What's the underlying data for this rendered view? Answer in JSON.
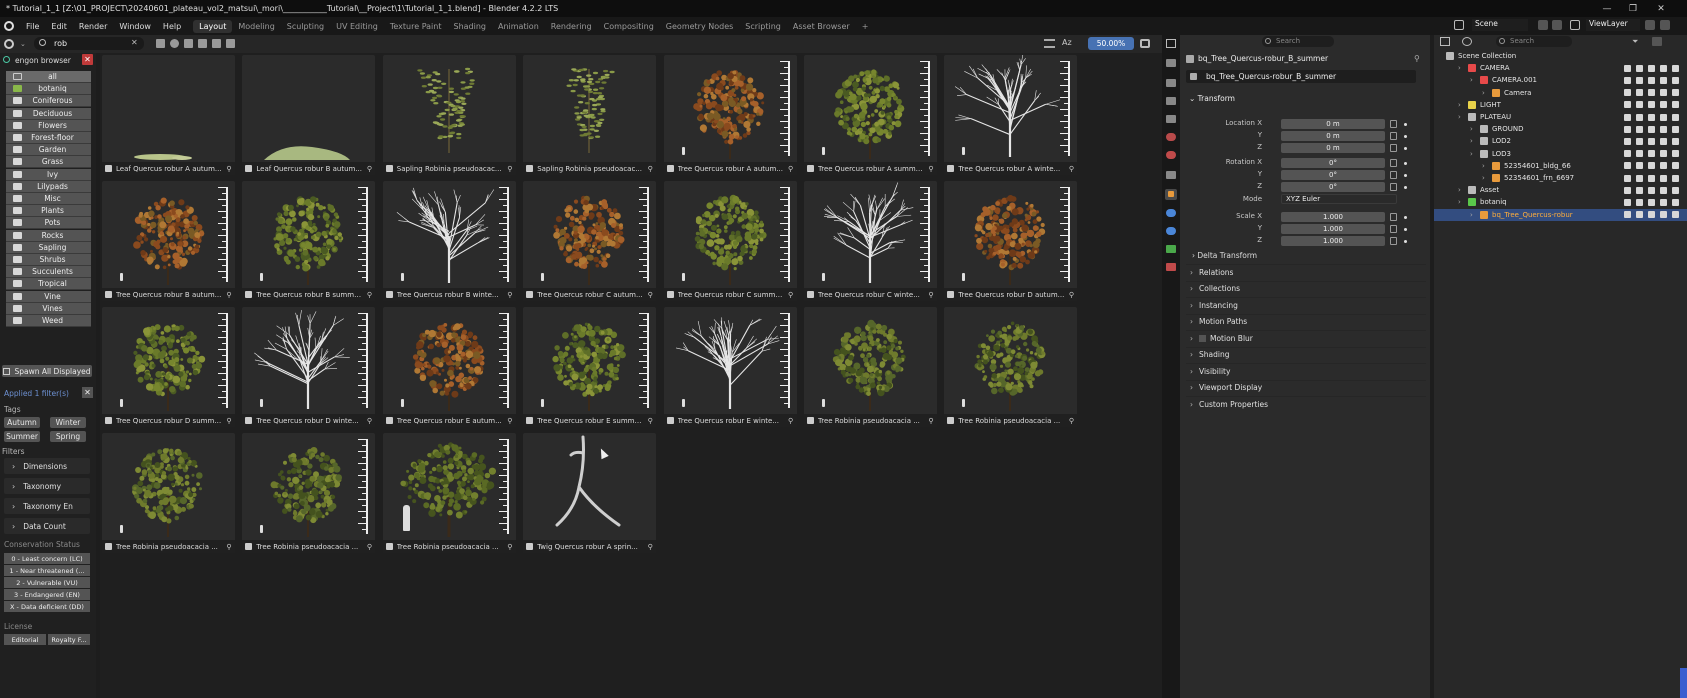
{
  "window": {
    "title": "* Tutorial_1_1 [Z:\\01_PROJECT\\20240601_plateau_vol2_matsui\\_mori\\___________Tutorial\\__Project\\1\\Tutorial_1_1.blend] - Blender 4.2.2 LTS",
    "controls": [
      "—",
      "❐",
      "✕"
    ]
  },
  "menu": [
    "File",
    "Edit",
    "Render",
    "Window",
    "Help"
  ],
  "workspaces": [
    "Layout",
    "Modeling",
    "Sculpting",
    "UV Editing",
    "Texture Paint",
    "Shading",
    "Animation",
    "Rendering",
    "Compositing",
    "Geometry Nodes",
    "Scripting",
    "Asset Browser"
  ],
  "workspace_active": "Layout",
  "workspace_add": "+",
  "scene": {
    "label": "Scene",
    "view_layer": "ViewLayer"
  },
  "browser": {
    "search_value": "rob",
    "zoom": "50.00%",
    "sort_label": "Az",
    "title": "engon browser",
    "close": "✕",
    "categories": [
      "all",
      "botaniq",
      "Coniferous",
      "Deciduous",
      "Flowers",
      "Forest-floor",
      "Garden",
      "Grass",
      "Ivy",
      "Lilypads",
      "Misc",
      "Plants",
      "Pots",
      "Rocks",
      "Sapling",
      "Shrubs",
      "Succulents",
      "Tropical",
      "Vine",
      "Vines",
      "Weed"
    ],
    "spawn_label": "Spawn All Displayed",
    "applied_filters": "Applied 1 filter(s)",
    "tags_label": "Tags",
    "tags": [
      "Autumn",
      "Winter",
      "Summer",
      "Spring"
    ],
    "filters_label": "Filters",
    "filters": [
      "Dimensions",
      "Taxonomy",
      "Taxonomy En",
      "Data Count"
    ],
    "conservation_label": "Conservation Status",
    "conservation": [
      "0 - Least concern (LC)",
      "1 - Near threatened (...",
      "2 - Vulnerable (VU)",
      "3 - Endangered (EN)",
      "X - Data deficient (DD)"
    ],
    "license_label": "License",
    "licenses": [
      "Editorial",
      "Royalty F..."
    ]
  },
  "assets": [
    {
      "name": "Leaf Quercus robur A autum...",
      "kind": "leafA"
    },
    {
      "name": "Leaf Quercus robur B autum...",
      "kind": "leafB"
    },
    {
      "name": "Sapling Robinia pseudoacac...",
      "kind": "sapling"
    },
    {
      "name": "Sapling Robinia pseudoacac...",
      "kind": "sapling2"
    },
    {
      "name": "Tree Quercus robur A autum...",
      "kind": "autumn"
    },
    {
      "name": "Tree Quercus robur A summe...",
      "kind": "summer"
    },
    {
      "name": "Tree Quercus robur A winte...",
      "kind": "winter"
    },
    {
      "name": "Tree Quercus robur B autum...",
      "kind": "autumn"
    },
    {
      "name": "Tree Quercus robur B summe...",
      "kind": "summer"
    },
    {
      "name": "Tree Quercus robur B winte...",
      "kind": "winter"
    },
    {
      "name": "Tree Quercus robur C autum...",
      "kind": "autumn"
    },
    {
      "name": "Tree Quercus robur C summe...",
      "kind": "summer"
    },
    {
      "name": "Tree Quercus robur C winte...",
      "kind": "winter"
    },
    {
      "name": "Tree Quercus robur D autum...",
      "kind": "autumn"
    },
    {
      "name": "Tree Quercus robur D summe...",
      "kind": "summer"
    },
    {
      "name": "Tree Quercus robur D winte...",
      "kind": "winter"
    },
    {
      "name": "Tree Quercus robur E autum...",
      "kind": "autumn"
    },
    {
      "name": "Tree Quercus robur E summe...",
      "kind": "summer"
    },
    {
      "name": "Tree Quercus robur E winte...",
      "kind": "winter"
    },
    {
      "name": "Tree Robinia pseudoacacia ...",
      "kind": "robinia"
    },
    {
      "name": "Tree Robinia pseudoacacia ...",
      "kind": "robinia"
    },
    {
      "name": "Tree Robinia pseudoacacia ...",
      "kind": "robinia"
    },
    {
      "name": "Tree Robinia pseudoacacia ...",
      "kind": "robinia"
    },
    {
      "name": "Tree Robinia pseudoacacia ...",
      "kind": "robiniaBig"
    },
    {
      "name": "Twig Quercus robur A sprin...",
      "kind": "twig"
    }
  ],
  "properties": {
    "object_name": "bq_Tree_Quercus-robur_B_summer",
    "data_name": "bq_Tree_Quercus-robur_B_summer",
    "transform_label": "Transform",
    "location_label": "Location X",
    "rotation_label": "Rotation X",
    "scale_label": "Scale X",
    "axis_y": "Y",
    "axis_z": "Z",
    "location": [
      "0 m",
      "0 m",
      "0 m"
    ],
    "rotation": [
      "0°",
      "0°",
      "0°"
    ],
    "mode_label": "Mode",
    "mode_value": "XYZ Euler",
    "scale": [
      "1.000",
      "1.000",
      "1.000"
    ],
    "delta": "Delta Transform",
    "sections": [
      "Relations",
      "Collections",
      "Instancing",
      "Motion Paths",
      "Motion Blur",
      "Shading",
      "Visibility",
      "Viewport Display",
      "Custom Properties"
    ],
    "search_placeholder": "Search"
  },
  "outliner": {
    "search_placeholder": "Search",
    "rows": [
      {
        "label": "Scene Collection",
        "indent": 0,
        "color": "#bbbbbb"
      },
      {
        "label": "CAMERA",
        "indent": 1,
        "color": "#e84a4a"
      },
      {
        "label": "CAMERA.001",
        "indent": 2,
        "color": "#e84a4a"
      },
      {
        "label": "Camera",
        "indent": 3,
        "color": "#e89a3c"
      },
      {
        "label": "LIGHT",
        "indent": 1,
        "color": "#e8d24a"
      },
      {
        "label": "PLATEAU",
        "indent": 1,
        "color": "#bbbbbb"
      },
      {
        "label": "GROUND",
        "indent": 2,
        "color": "#bbbbbb"
      },
      {
        "label": "LOD2",
        "indent": 2,
        "color": "#bbbbbb"
      },
      {
        "label": "LOD3",
        "indent": 2,
        "color": "#bbbbbb"
      },
      {
        "label": "52354601_bldg_66",
        "indent": 3,
        "color": "#e89a3c"
      },
      {
        "label": "52354601_frn_6697",
        "indent": 3,
        "color": "#e89a3c"
      },
      {
        "label": "Asset",
        "indent": 1,
        "color": "#bbbbbb"
      },
      {
        "label": "botaniq",
        "indent": 1,
        "color": "#5ac84a"
      },
      {
        "label": "bq_Tree_Quercus-robur",
        "indent": 2,
        "color": "#e89a3c",
        "selected": true
      }
    ]
  },
  "colors": {
    "accent": "#4772b3",
    "selected_row": "#334d80",
    "active_text": "#ffae3c"
  }
}
